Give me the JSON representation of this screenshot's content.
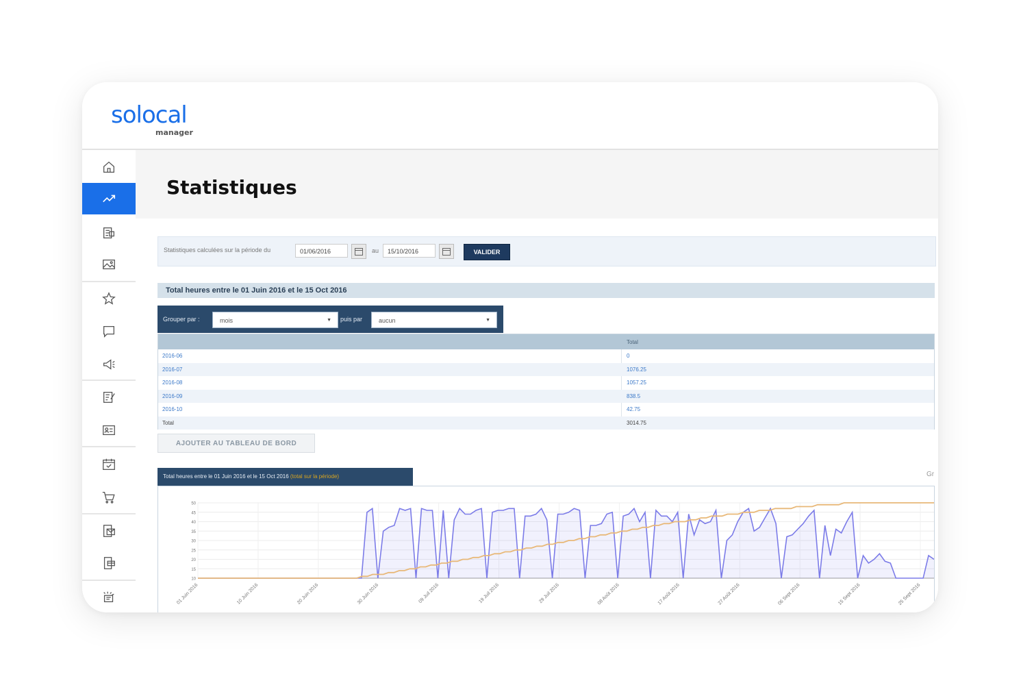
{
  "brand": {
    "logo_text": "solocal",
    "logo_sub": "manager",
    "accent": "#1a6fe8"
  },
  "sidebar": {
    "items": [
      {
        "name": "home-icon",
        "active": false
      },
      {
        "name": "statistics-icon",
        "active": true
      },
      {
        "name": "listing-icon",
        "active": false
      },
      {
        "name": "image-icon",
        "active": false
      },
      {
        "name": "star-icon",
        "active": false
      },
      {
        "name": "chat-icon",
        "active": false
      },
      {
        "name": "megaphone-icon",
        "active": false
      },
      {
        "name": "edit-document-icon",
        "active": false
      },
      {
        "name": "contact-card-icon",
        "active": false
      },
      {
        "name": "calendar-check-icon",
        "active": false
      },
      {
        "name": "cart-icon",
        "active": false
      },
      {
        "name": "mail-icon",
        "active": false
      },
      {
        "name": "payment-icon",
        "active": false
      },
      {
        "name": "settings-sparkle-icon",
        "active": false
      }
    ]
  },
  "page": {
    "title": "Statistiques"
  },
  "filter": {
    "label": "Statistiques calculées sur la période du",
    "date_from": "01/06/2016",
    "au_label": "au",
    "date_to": "15/10/2016",
    "validate_label": "VALIDER"
  },
  "summary": {
    "title": "Total heures entre le 01 Juin 2016 et le 15 Oct 2016"
  },
  "grouping": {
    "group_label": "Grouper par :",
    "group_value": "mois",
    "then_label": "puis par",
    "then_value": "aucun"
  },
  "table": {
    "total_header": "Total",
    "rows": [
      {
        "label": "2016-06",
        "value": "0"
      },
      {
        "label": "2016-07",
        "value": "1076.25"
      },
      {
        "label": "2016-08",
        "value": "1057.25"
      },
      {
        "label": "2016-09",
        "value": "838.5"
      },
      {
        "label": "2016-10",
        "value": "42.75"
      }
    ],
    "total_row": {
      "label": "Total",
      "value": "3014.75"
    }
  },
  "add_button_label": "AJOUTER AU TABLEAU DE BORD",
  "chart_panel": {
    "tab_title": "Total heures entre le 01 Juin 2016 et le 15 Oct 2016",
    "tab_highlight": "(total sur la période)",
    "side_label": "Gr"
  },
  "chart_data": {
    "type": "line",
    "title": "Total heures entre le 01 Juin 2016 et le 15 Oct 2016",
    "ylim": [
      10,
      50
    ],
    "y_ticks": [
      "50",
      "45",
      "40",
      "35",
      "30",
      "25",
      "20",
      "15",
      "10"
    ],
    "x_ticks": [
      "01 Juin 2016",
      "10 Juin 2016",
      "20 Juin 2016",
      "30 Juin 2016",
      "09 Juil 2016",
      "19 Juil 2016",
      "29 Juil 2016",
      "08 Août 2016",
      "17 Août 2016",
      "27 Août 2016",
      "06 Sept 2016",
      "15 Sept 2016",
      "25 Sept 2016"
    ],
    "series": [
      {
        "color": "#7b7be8",
        "values": [
          10,
          10,
          10,
          10,
          10,
          10,
          10,
          10,
          10,
          10,
          10,
          10,
          10,
          10,
          10,
          10,
          10,
          10,
          10,
          10,
          10,
          10,
          10,
          10,
          10,
          10,
          10,
          10,
          10,
          10,
          10,
          45,
          47,
          10,
          35,
          37,
          38,
          47,
          46,
          47,
          10,
          47,
          46,
          46,
          10,
          46,
          10,
          41,
          47,
          44,
          44,
          46,
          47,
          10,
          45,
          46,
          46,
          47,
          47,
          10,
          43,
          43,
          44,
          47,
          41,
          10,
          44,
          44,
          45,
          47,
          46,
          10,
          38,
          38,
          39,
          44,
          45,
          10,
          43,
          44,
          47,
          40,
          45,
          10,
          46,
          43,
          43,
          40,
          45,
          10,
          44,
          33,
          41,
          39,
          40,
          46,
          10,
          30,
          33,
          40,
          45,
          47,
          35,
          37,
          42,
          47,
          39,
          10,
          32,
          33,
          36,
          39,
          43,
          46,
          10,
          38,
          22,
          36,
          34,
          40,
          45,
          10,
          22,
          18,
          20,
          23,
          19,
          18,
          10,
          10,
          10,
          10,
          10,
          10,
          22,
          20
        ]
      },
      {
        "color": "#e8b878",
        "values": [
          10,
          10,
          10,
          10,
          10,
          10,
          10,
          10,
          10,
          10,
          10,
          10,
          10,
          10,
          10,
          10,
          10,
          10,
          10,
          10,
          10,
          10,
          10,
          10,
          10,
          10,
          10,
          10,
          10,
          10,
          10,
          11,
          11,
          12,
          12,
          12,
          13,
          13,
          14,
          14,
          15,
          15,
          16,
          16,
          17,
          17,
          18,
          18,
          19,
          19,
          20,
          20,
          21,
          21,
          22,
          22,
          23,
          23,
          24,
          24,
          25,
          25,
          26,
          26,
          27,
          27,
          28,
          28,
          29,
          29,
          30,
          30,
          31,
          31,
          32,
          32,
          33,
          33,
          34,
          34,
          35,
          35,
          36,
          36,
          37,
          37,
          38,
          38,
          39,
          39,
          40,
          40,
          40,
          41,
          41,
          42,
          42,
          43,
          43,
          43,
          44,
          44,
          44,
          45,
          45,
          45,
          46,
          46,
          46,
          47,
          47,
          47,
          47,
          48,
          48,
          48,
          48,
          49,
          49,
          49,
          49,
          49,
          50,
          50,
          50,
          50,
          50,
          50,
          50,
          50,
          50,
          50,
          50,
          50,
          50,
          50,
          50,
          50,
          50,
          50
        ]
      }
    ]
  }
}
